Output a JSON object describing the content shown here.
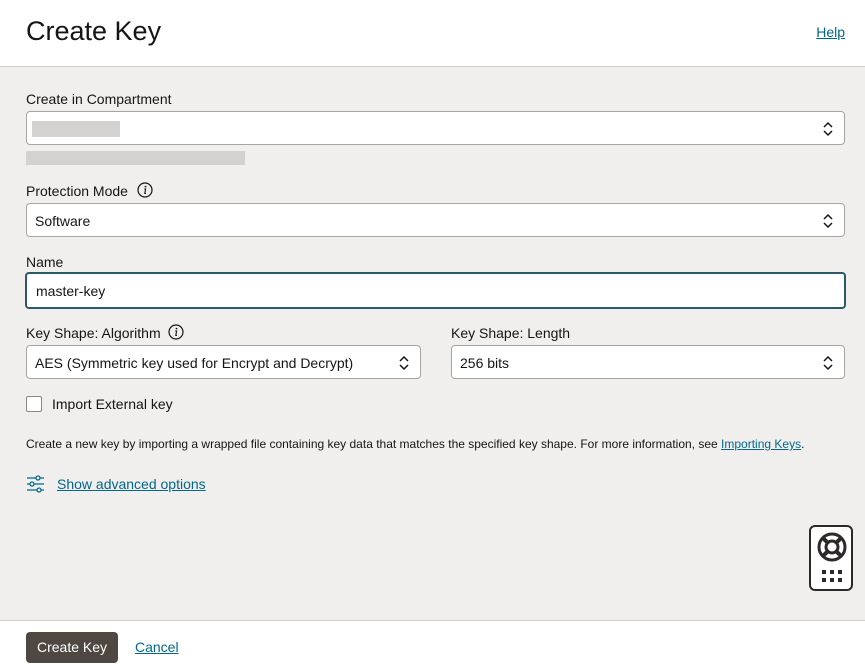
{
  "header": {
    "title": "Create Key",
    "help_label": "Help"
  },
  "form": {
    "compartment": {
      "label": "Create in Compartment"
    },
    "protection_mode": {
      "label": "Protection Mode",
      "value": "Software"
    },
    "name": {
      "label": "Name",
      "value": "master-key"
    },
    "algorithm": {
      "label": "Key Shape: Algorithm",
      "value": "AES (Symmetric key used for Encrypt and Decrypt)"
    },
    "length": {
      "label": "Key Shape: Length",
      "value": "256 bits"
    },
    "import_external": {
      "label": "Import External key",
      "checked": false
    },
    "note": {
      "text": "Create a new key by importing a wrapped file containing key data that matches the specified key shape. For more information, see ",
      "link": "Importing Keys",
      "suffix": "."
    },
    "advanced_label": "Show advanced options"
  },
  "footer": {
    "create_label": "Create Key",
    "cancel_label": "Cancel"
  },
  "icons": {
    "chevron": "chevron-updown-icon",
    "info": "info-icon",
    "advanced": "sliders-icon",
    "help_widget": "lifebuoy-icon",
    "apps": "grid-icon"
  },
  "colors": {
    "link": "#00688c",
    "primary_button": "#4f4842",
    "focus_border": "#2c5967"
  }
}
